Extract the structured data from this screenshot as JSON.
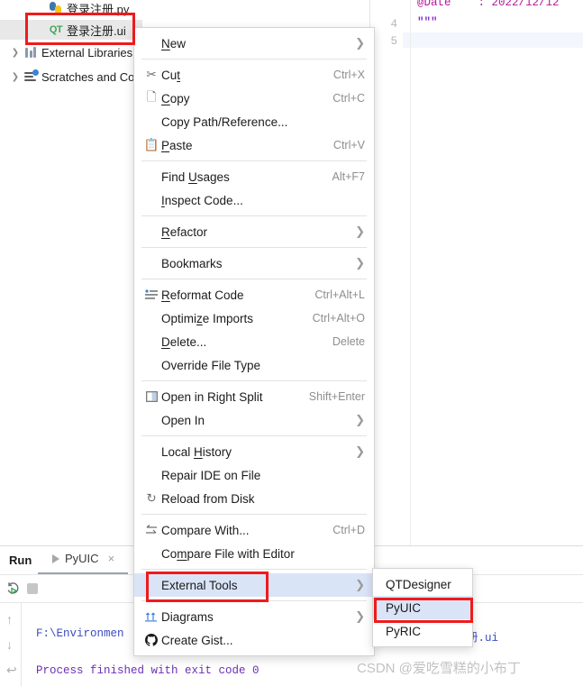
{
  "colors": {
    "annotation": "#ee1b1b",
    "menu_highlight": "#dae4f7",
    "tree_selection": "#e8e8e8",
    "qt_icon": "#3ea65a"
  },
  "project_tree": {
    "items": [
      {
        "label": "登录注册.py",
        "icon": "python-file-icon",
        "selected": false,
        "expandable": false
      },
      {
        "label": "登录注册.ui",
        "icon": "qt-designer-file-icon",
        "selected": true,
        "expandable": false
      },
      {
        "label": "External Libraries",
        "icon": "libraries-icon",
        "selected": false,
        "expandable": true
      },
      {
        "label": "Scratches and Consoles",
        "icon": "scratches-icon",
        "selected": false,
        "expandable": true
      }
    ]
  },
  "editor": {
    "lines": [
      {
        "number": "",
        "text": "@Date    : 2022/12/12"
      },
      {
        "number": "4",
        "text": "\"\"\""
      },
      {
        "number": "5",
        "text": ""
      }
    ]
  },
  "context_menu": {
    "items": [
      {
        "label": "New",
        "accel": "",
        "icon": "",
        "arrow": true,
        "mnemonic": "N",
        "highlighted": false
      },
      {
        "separator": true
      },
      {
        "label": "Cut",
        "accel": "Ctrl+X",
        "icon": "scissors-icon",
        "arrow": false,
        "mnemonic": "t",
        "highlighted": false
      },
      {
        "label": "Copy",
        "accel": "Ctrl+C",
        "icon": "copy-icon",
        "arrow": false,
        "mnemonic": "C",
        "highlighted": false
      },
      {
        "label": "Copy Path/Reference...",
        "accel": "",
        "icon": "",
        "arrow": false,
        "highlighted": false
      },
      {
        "label": "Paste",
        "accel": "Ctrl+V",
        "icon": "clipboard-icon",
        "arrow": false,
        "mnemonic": "P",
        "highlighted": false
      },
      {
        "separator": true
      },
      {
        "label": "Find Usages",
        "accel": "Alt+F7",
        "icon": "",
        "arrow": false,
        "mnemonic": "U",
        "highlighted": false
      },
      {
        "label": "Inspect Code...",
        "accel": "",
        "icon": "",
        "arrow": false,
        "mnemonic": "I",
        "highlighted": false
      },
      {
        "separator": true
      },
      {
        "label": "Refactor",
        "accel": "",
        "icon": "",
        "arrow": true,
        "mnemonic": "R",
        "highlighted": false
      },
      {
        "separator": true
      },
      {
        "label": "Bookmarks",
        "accel": "",
        "icon": "",
        "arrow": true,
        "highlighted": false
      },
      {
        "separator": true
      },
      {
        "label": "Reformat Code",
        "accel": "Ctrl+Alt+L",
        "icon": "reformat-icon",
        "arrow": false,
        "mnemonic": "R",
        "highlighted": false
      },
      {
        "label": "Optimize Imports",
        "accel": "Ctrl+Alt+O",
        "icon": "",
        "arrow": false,
        "mnemonic": "z",
        "highlighted": false
      },
      {
        "label": "Delete...",
        "accel": "Delete",
        "icon": "",
        "arrow": false,
        "mnemonic": "D",
        "highlighted": false
      },
      {
        "label": "Override File Type",
        "accel": "",
        "icon": "",
        "arrow": false,
        "highlighted": false
      },
      {
        "separator": true
      },
      {
        "label": "Open in Right Split",
        "accel": "Shift+Enter",
        "icon": "split-icon",
        "arrow": false,
        "highlighted": false
      },
      {
        "label": "Open In",
        "accel": "",
        "icon": "",
        "arrow": true,
        "highlighted": false
      },
      {
        "separator": true
      },
      {
        "label": "Local History",
        "accel": "",
        "icon": "",
        "arrow": true,
        "mnemonic": "H",
        "highlighted": false
      },
      {
        "label": "Repair IDE on File",
        "accel": "",
        "icon": "",
        "arrow": false,
        "highlighted": false
      },
      {
        "label": "Reload from Disk",
        "accel": "",
        "icon": "reload-icon",
        "arrow": false,
        "highlighted": false
      },
      {
        "separator": true
      },
      {
        "label": "Compare With...",
        "accel": "Ctrl+D",
        "icon": "compare-icon",
        "arrow": false,
        "highlighted": false
      },
      {
        "label": "Compare File with Editor",
        "accel": "",
        "icon": "",
        "arrow": false,
        "mnemonic": "m",
        "highlighted": false
      },
      {
        "separator": true
      },
      {
        "label": "External Tools",
        "accel": "",
        "icon": "",
        "arrow": true,
        "highlighted": true
      },
      {
        "separator": true
      },
      {
        "label": "Diagrams",
        "accel": "",
        "icon": "diagrams-icon",
        "arrow": true,
        "highlighted": false
      },
      {
        "label": "Create Gist...",
        "accel": "",
        "icon": "github-icon",
        "arrow": false,
        "highlighted": false
      }
    ]
  },
  "submenu": {
    "items": [
      {
        "label": "QTDesigner",
        "highlighted": false
      },
      {
        "label": "PyUIC",
        "highlighted": true
      },
      {
        "label": "PyRIC",
        "highlighted": false
      }
    ]
  },
  "run_window": {
    "title": "Run",
    "tab_label": "PyUIC",
    "tab_close": "×",
    "toolbar": {
      "rerun": "rerun-icon",
      "stop": "stop-icon",
      "scroll_up": "↑",
      "scroll_down": "↓",
      "soft_wrap": "↩"
    },
    "console_lines": [
      {
        "text": "F:\\Environmen",
        "color": "#3b4cc0"
      },
      {
        "text": "yuic 登录注册.ui",
        "color": "#3b4cc0"
      },
      {
        "text": "Process finished with exit code 0",
        "color": "#6a2fb5"
      }
    ]
  },
  "annotations": {
    "boxes": [
      {
        "name": "selected-ui-file-highlight"
      },
      {
        "name": "external-tools-highlight"
      },
      {
        "name": "pyuic-highlight"
      }
    ],
    "watermark": "CSDN @爱吃雪糕的小布丁"
  }
}
